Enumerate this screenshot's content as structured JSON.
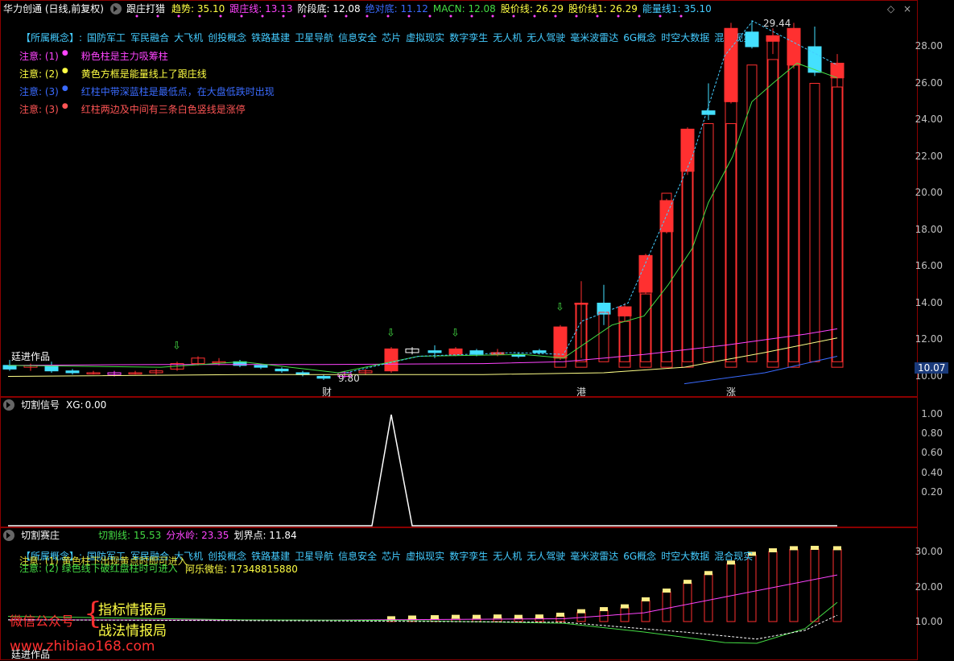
{
  "main_header": {
    "title": "华力创通 (日线,前复权)",
    "arrow_label": "↑",
    "indicator_name": "跟庄打猎",
    "items": [
      {
        "label": "趋势:",
        "value": "35.10",
        "color": "#ffffff"
      },
      {
        "label": "跟庄线:",
        "value": "13.13",
        "color": "#ff44ff"
      },
      {
        "label": "阶段底:",
        "value": "12.08",
        "color": "#ffffff"
      },
      {
        "label": "绝对底:",
        "value": "11.12",
        "color": "#3a6bff"
      },
      {
        "label": "MACN:",
        "value": "12.08",
        "color": "#44dd44"
      },
      {
        "label": "股价线:",
        "value": "26.29",
        "color": "#ffff44"
      },
      {
        "label": "股价线1:",
        "value": "26.29",
        "color": "#ffff44"
      },
      {
        "label": "能量线1:",
        "value": "35.10",
        "color": "#44ccff"
      }
    ]
  },
  "concepts_label": "【所属概念】:",
  "concepts": [
    "国防军工",
    "军民融合",
    "大飞机",
    "创投概念",
    "铁路基建",
    "卫星导航",
    "信息安全",
    "芯片",
    "虚拟现实",
    "数字孪生",
    "无人机",
    "无人驾驶",
    "毫米波雷达",
    "6G概念",
    "时空大数据",
    "混合现实"
  ],
  "notes": [
    {
      "prefix": "注意: (1)",
      "dot_color": "#ff44ff",
      "text": "粉色柱是主力吸筹柱",
      "color": "#ff44ff"
    },
    {
      "prefix": "注意: (2)",
      "dot_color": "#ffff44",
      "text": "黄色方框是能量线上了跟庄线",
      "color": "#ffff44"
    },
    {
      "prefix": "注意: (3)",
      "dot_color": "#3a6bff",
      "text": "红柱中带深蓝柱是最低点，在大盘低跌时出现",
      "color": "#3a6bff"
    },
    {
      "prefix": "注意: (3)",
      "dot_color": "#ff5555",
      "text": "红柱两边及中间有三条白色竖线是涨停",
      "color": "#ff5555"
    }
  ],
  "watermark_top": "廷进作品",
  "price_axis": [
    "28.00",
    "26.00",
    "24.00",
    "22.00",
    "20.00",
    "18.00",
    "16.00",
    "14.00",
    "12.00",
    "10.00"
  ],
  "price_badge": "10.07",
  "high_label": "29.44",
  "low_label": "9.80",
  "event_markers": [
    "财",
    "港",
    "涨"
  ],
  "panel2_header": {
    "name": "切割信号",
    "label": "XG:",
    "value": "0.00"
  },
  "panel2_axis": [
    "1.00",
    "0.80",
    "0.60",
    "0.40",
    "0.20"
  ],
  "panel3_header": {
    "name": "切割赛庄",
    "items": [
      {
        "label": "切割线:",
        "value": "15.53",
        "color": "#44dd44"
      },
      {
        "label": "分水岭:",
        "value": "23.35",
        "color": "#ff44ff"
      },
      {
        "label": "划界点:",
        "value": "11.84",
        "color": "#ffffff"
      }
    ]
  },
  "panel3_axis": [
    "30.00",
    "20.00",
    "10.00"
  ],
  "panel3_notes": [
    {
      "text": "注意: (1) 黄色柱下出现黄点时即可进入",
      "color": "#ffff44"
    },
    {
      "text": "注意: (2) 绿色线下破红盘柱时可进入",
      "color": "#44dd44"
    }
  ],
  "contact": "阿乐微信: 17348815880",
  "promo": {
    "left": "微信公众号",
    "line1": "指标情报局",
    "line2": "战法情报局",
    "site": "www.zhibiao168.com"
  },
  "watermark_bottom": "廷进作品",
  "colors": {
    "up": "#ff3030",
    "down": "#44e0ff",
    "border": "#8b0000"
  }
}
